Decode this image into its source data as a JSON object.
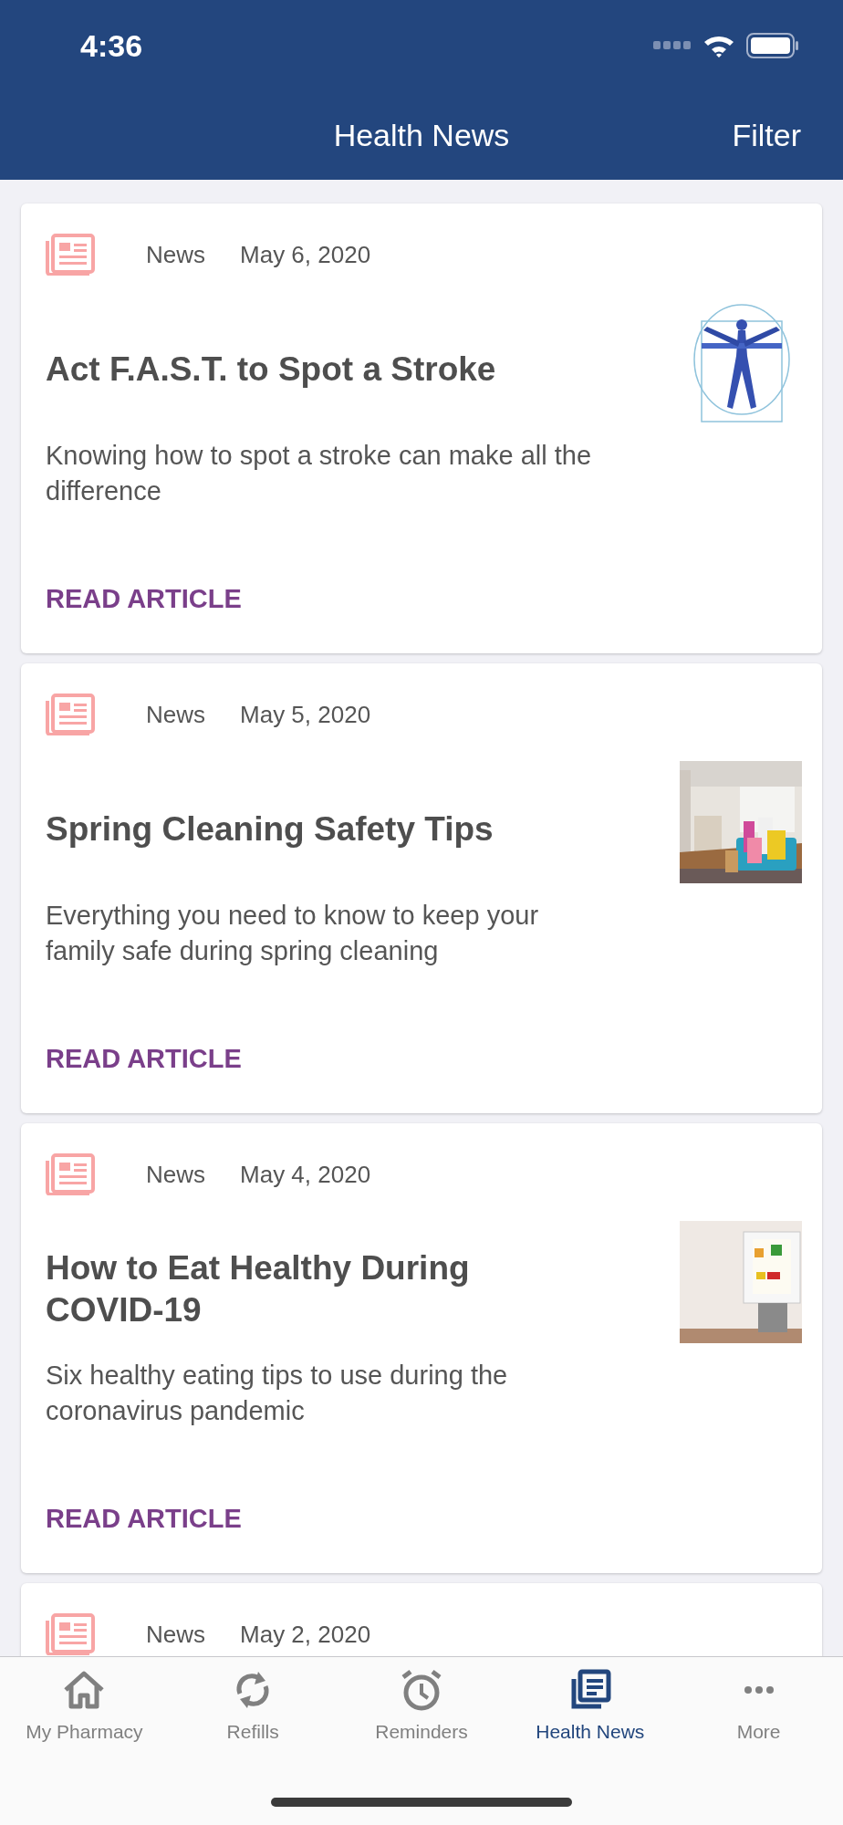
{
  "status_bar": {
    "time": "4:36"
  },
  "nav_bar": {
    "title": "Health News",
    "action": "Filter"
  },
  "articles": [
    {
      "category": "News",
      "date": "May 6, 2020",
      "title": "Act F.A.S.T. to Spot a Stroke",
      "summary": "Knowing how to spot a stroke can make all the difference",
      "link": "READ ARTICLE"
    },
    {
      "category": "News",
      "date": "May 5, 2020",
      "title": "Spring Cleaning Safety Tips",
      "summary": "Everything you need to know to keep your family safe during spring cleaning",
      "link": "READ ARTICLE"
    },
    {
      "category": "News",
      "date": "May 4, 2020",
      "title": "How to Eat Healthy During COVID-19",
      "summary": "Six healthy eating tips to use during the coronavirus pandemic",
      "link": "READ ARTICLE"
    },
    {
      "category": "News",
      "date": "May 2, 2020"
    }
  ],
  "tab_bar": [
    {
      "kind": "home",
      "label": "My Pharmacy",
      "selected": false
    },
    {
      "kind": "refresh",
      "label": "Refills",
      "selected": false
    },
    {
      "kind": "alarm",
      "label": "Reminders",
      "selected": false
    },
    {
      "kind": "news",
      "label": "Health News",
      "selected": true
    },
    {
      "kind": "more",
      "label": "More",
      "selected": false
    }
  ]
}
